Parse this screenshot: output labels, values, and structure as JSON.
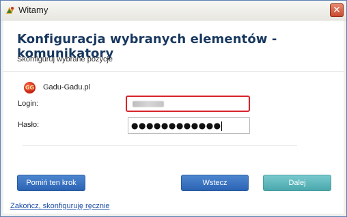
{
  "window": {
    "title": "Witamy",
    "close_label": "✕"
  },
  "main": {
    "heading": "Konfiguracja wybranych elementów - komunikatory",
    "subheading": "Skonfiguruj wybrane pozycje"
  },
  "service": {
    "logo_text": "GG",
    "name": "Gadu-Gadu.pl"
  },
  "form": {
    "login_label": "Login:",
    "login_value": "",
    "password_label": "Hasło:",
    "password_value": "●●●●●●●●●●●●"
  },
  "buttons": {
    "skip": "Pomiń ten krok",
    "back": "Wstecz",
    "next": "Dalej"
  },
  "link": {
    "manual": "Zakończ, skonfiguruję ręcznie"
  },
  "colors": {
    "heading": "#17375e",
    "login_highlight": "#d8232a",
    "button_blue": "#2c64b4",
    "button_teal": "#4aa8ad",
    "link": "#1f4fa8"
  }
}
